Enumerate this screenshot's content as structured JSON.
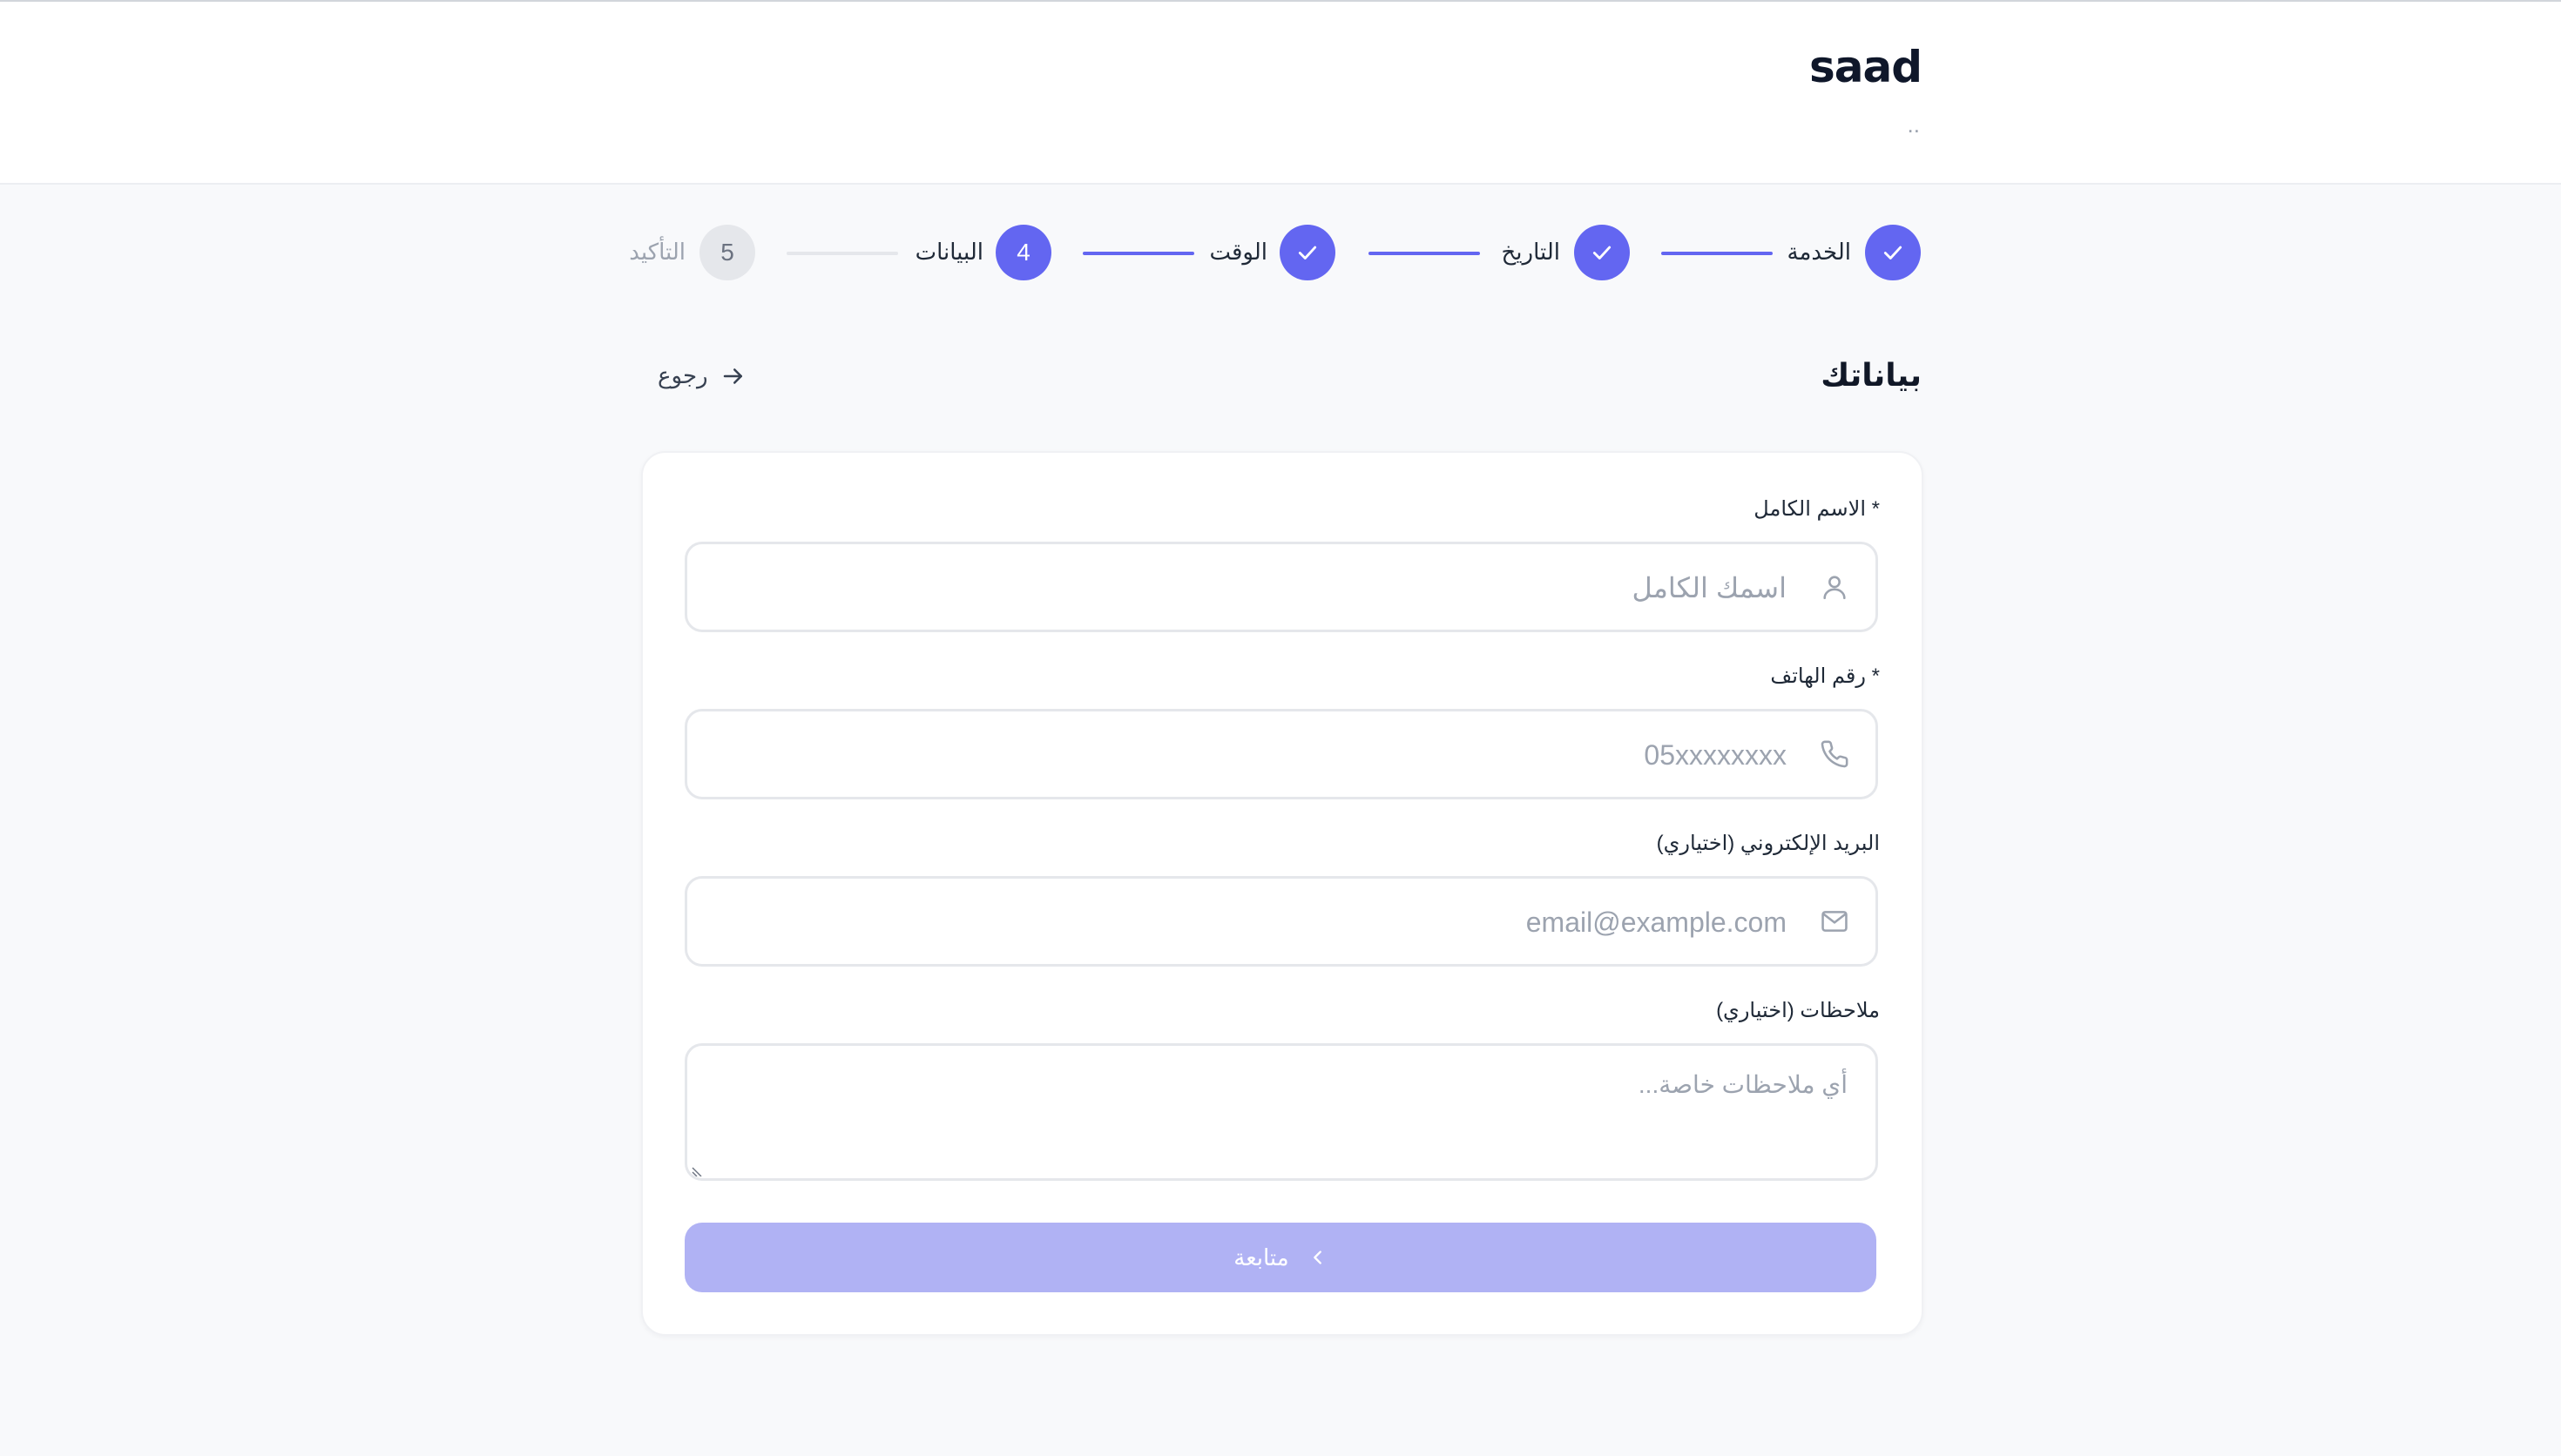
{
  "brand": {
    "name": "saad",
    "subtitle": ".."
  },
  "stepper": {
    "steps": [
      {
        "label": "الخدمة",
        "number": "",
        "state": "done"
      },
      {
        "label": "التاريخ",
        "number": "",
        "state": "done"
      },
      {
        "label": "الوقت",
        "number": "",
        "state": "done"
      },
      {
        "label": "البيانات",
        "number": "4",
        "state": "current"
      },
      {
        "label": "التأكيد",
        "number": "5",
        "state": "todo"
      }
    ]
  },
  "section": {
    "title": "بياناتك",
    "back_label": "رجوع"
  },
  "form": {
    "full_name": {
      "label": "الاسم الكامل *",
      "placeholder": "اسمك الكامل",
      "value": ""
    },
    "phone": {
      "label": "رقم الهاتف *",
      "placeholder": "05xxxxxxxx",
      "value": ""
    },
    "email": {
      "label": "البريد الإلكتروني (اختياري)",
      "placeholder": "email@example.com",
      "value": ""
    },
    "notes": {
      "label": "ملاحظات (اختياري)",
      "placeholder": "أي ملاحظات خاصة...",
      "value": ""
    },
    "submit_label": "متابعة"
  },
  "icons": {
    "check": "check-icon",
    "user": "user-icon",
    "phone": "phone-icon",
    "mail": "mail-icon",
    "arrow_back": "arrow-right-icon",
    "chevron": "chevron-left-icon"
  },
  "colors": {
    "accent": "#6366f1",
    "accent_disabled": "#b0b2f4",
    "inactive_step": "#e5e7eb"
  }
}
